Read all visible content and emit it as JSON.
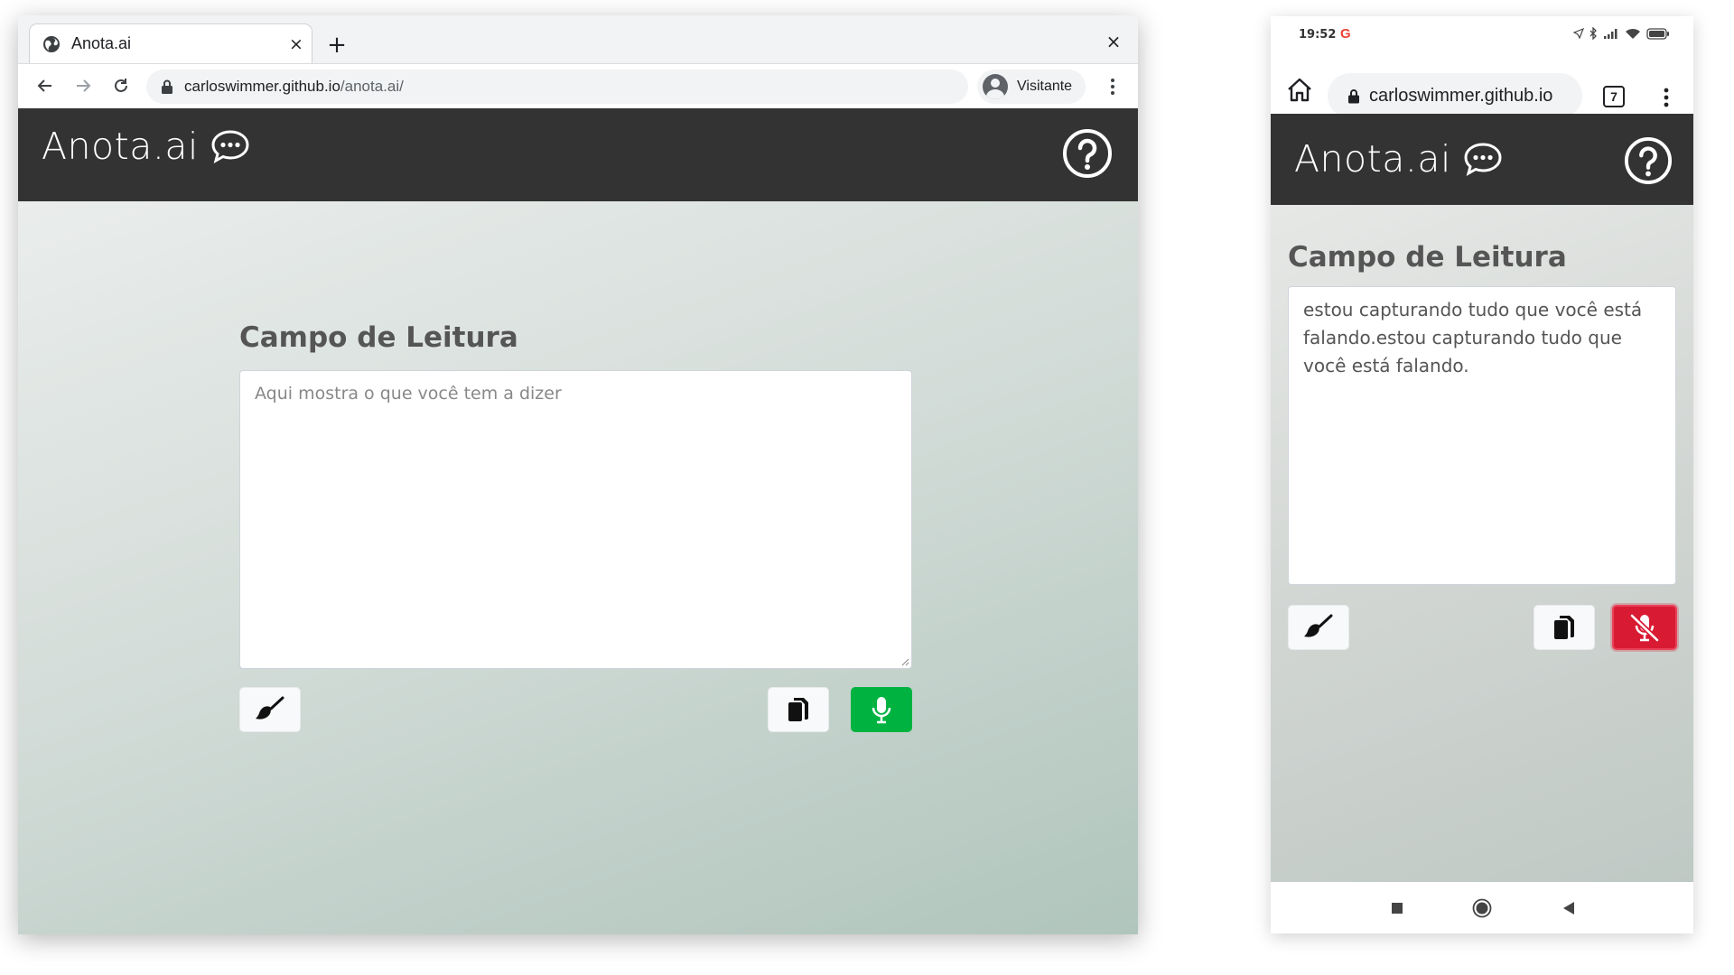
{
  "desktop": {
    "tab": {
      "title": "Anota.ai",
      "close": "×"
    },
    "new_tab": "+",
    "window_close": "×",
    "address": {
      "domain": "carloswimmer.github.io",
      "path": "/anota.ai/"
    },
    "profile": "Visitante",
    "app": {
      "logo": "Anota.ai",
      "field_title": "Campo de Leitura",
      "textarea": {
        "placeholder": "Aqui mostra o que você tem a dizer",
        "value": ""
      }
    }
  },
  "mobile": {
    "status": {
      "time": "19:52",
      "g": "G"
    },
    "address": {
      "domain": "carloswimmer.github.io"
    },
    "tab_count": "7",
    "app": {
      "logo": "Anota.ai",
      "field_title": "Campo de Leitura",
      "textarea": {
        "value": "estou capturando tudo que você está falando.estou capturando tudo que você está falando."
      }
    }
  },
  "colors": {
    "app_bar": "#333333",
    "mic_active": "#00b341",
    "mic_muted": "#d81b33",
    "title_text": "#555555"
  },
  "icons": {
    "clear": "broom-icon",
    "copy": "copy-icon",
    "record": "microphone-icon",
    "stop": "microphone-slash-icon",
    "help": "question-circle-icon",
    "logo": "speech-bubble-icon"
  }
}
